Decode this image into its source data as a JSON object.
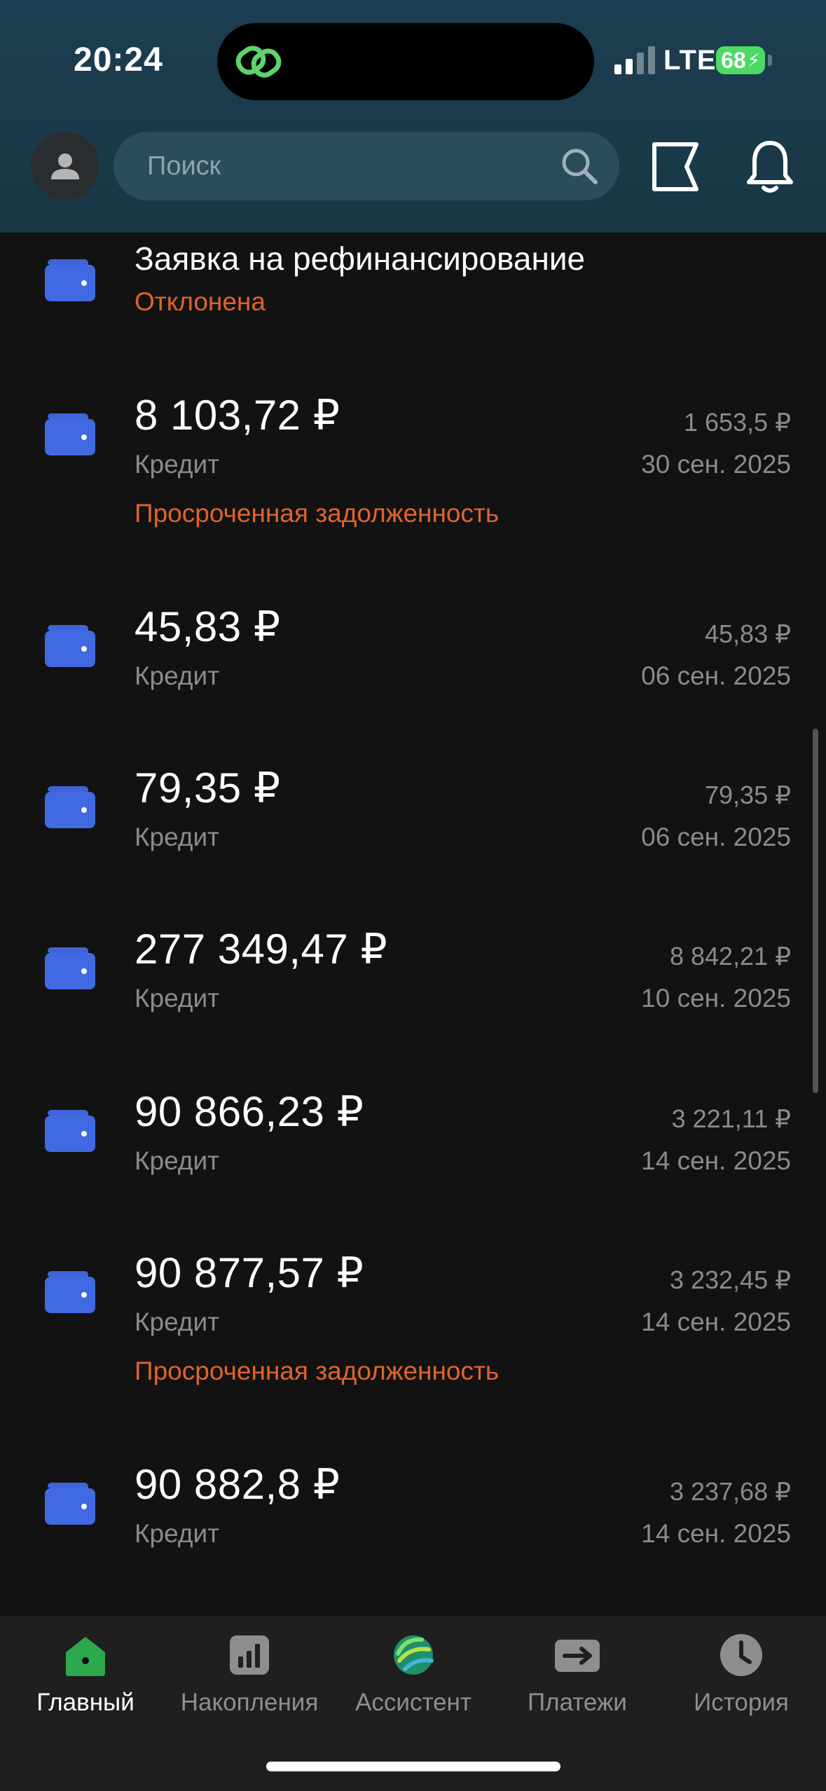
{
  "status_bar": {
    "time": "20:24",
    "network": "LTE",
    "battery": "68"
  },
  "header": {
    "search_placeholder": "Поиск"
  },
  "items": [
    {
      "title": "Заявка на рефинансирование",
      "status": "Отклонена"
    },
    {
      "amount": "8 103,72 ₽",
      "type": "Кредит",
      "payment": "1 653,5 ₽",
      "date": "30 сен. 2025",
      "warning": "Просроченная задолженность"
    },
    {
      "amount": "45,83 ₽",
      "type": "Кредит",
      "payment": "45,83 ₽",
      "date": "06 сен. 2025"
    },
    {
      "amount": "79,35 ₽",
      "type": "Кредит",
      "payment": "79,35 ₽",
      "date": "06 сен. 2025"
    },
    {
      "amount": "277 349,47 ₽",
      "type": "Кредит",
      "payment": "8 842,21 ₽",
      "date": "10 сен. 2025"
    },
    {
      "amount": "90 866,23 ₽",
      "type": "Кредит",
      "payment": "3 221,11 ₽",
      "date": "14 сен. 2025"
    },
    {
      "amount": "90 877,57 ₽",
      "type": "Кредит",
      "payment": "3 232,45 ₽",
      "date": "14 сен. 2025",
      "warning": "Просроченная задолженность"
    },
    {
      "amount": "90 882,8 ₽",
      "type": "Кредит",
      "payment": "3 237,68 ₽",
      "date": "14 сен. 2025"
    }
  ],
  "tabs": [
    {
      "label": "Главный",
      "icon": "home-icon"
    },
    {
      "label": "Накопления",
      "icon": "savings-icon"
    },
    {
      "label": "Ассистент",
      "icon": "assistant-icon"
    },
    {
      "label": "Платежи",
      "icon": "payments-icon"
    },
    {
      "label": "История",
      "icon": "history-icon"
    }
  ],
  "colors": {
    "accent_blue": "#4169e1",
    "warning_orange": "#e0642a",
    "active_green": "#2ea84f",
    "background": "#121212"
  }
}
